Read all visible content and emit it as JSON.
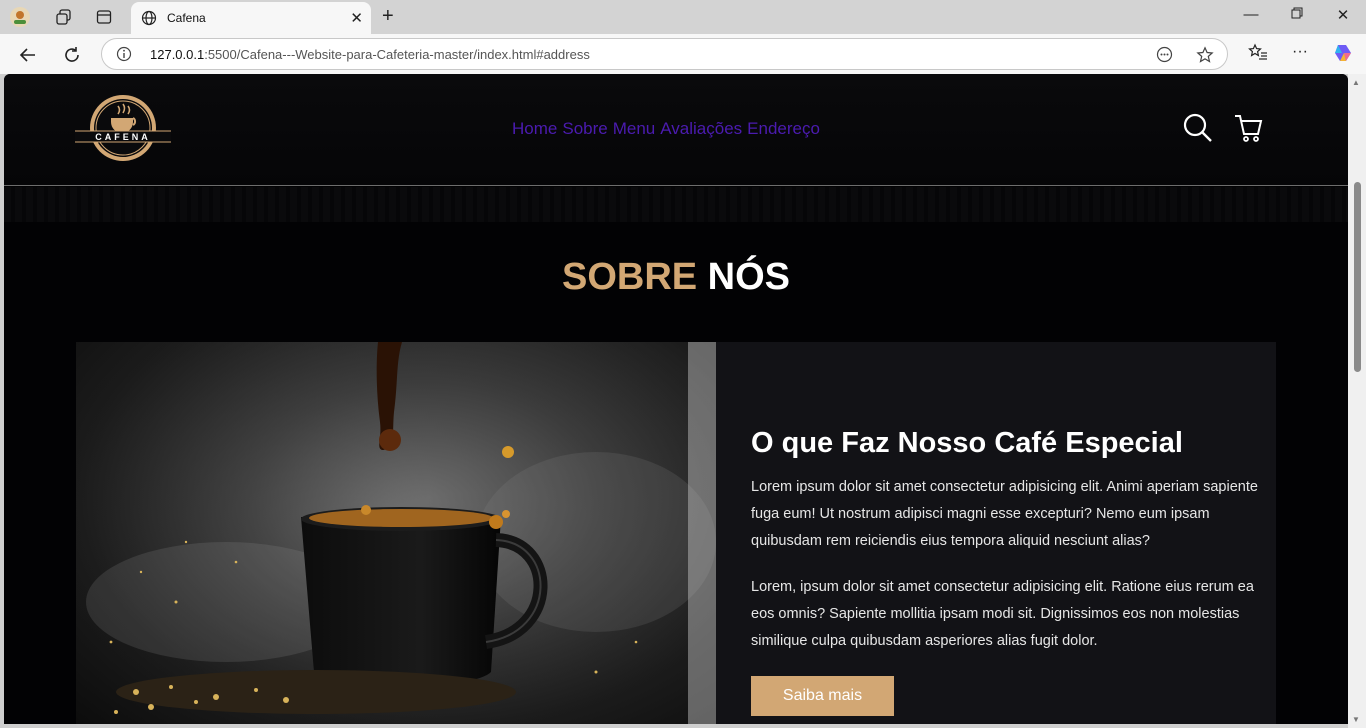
{
  "browser": {
    "tab_title": "Cafena",
    "url_host": "127.0.0.1",
    "url_rest": ":5500/Cafena---Website-para-Cafeteria-master/index.html#address"
  },
  "site": {
    "logo_text": "CAFENA",
    "nav": [
      "Home",
      "Sobre",
      "Menu",
      "Avaliações",
      "Endereço"
    ],
    "section_title_a": "SOBRE",
    "section_title_b": "NÓS",
    "about": {
      "heading": "O que Faz Nosso Café Especial",
      "p1": "Lorem ipsum dolor sit amet consectetur adipisicing elit. Animi aperiam sapiente fuga eum! Ut nostrum adipisci magni esse excepturi? Nemo eum ipsam quibusdam rem reiciendis eius tempora aliquid nesciunt alias?",
      "p2": "Lorem, ipsum dolor sit amet consectetur adipisicing elit. Ratione eius rerum ea eos omnis? Sapiente mollitia ipsam modi sit. Dignissimos eos non molestias similique culpa quibusdam asperiores alias fugit dolor.",
      "button": "Saiba mais"
    }
  },
  "colors": {
    "accent": "#d2a774",
    "nav_link": "#4b1bb0",
    "page_bg": "#020204"
  }
}
